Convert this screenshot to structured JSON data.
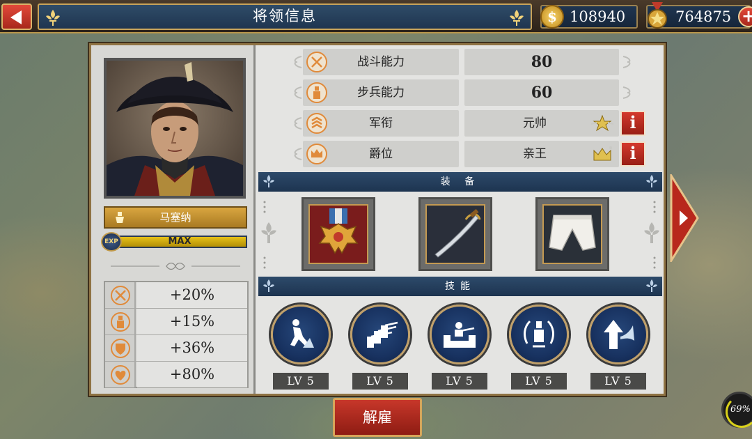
{
  "header": {
    "title": "将领信息",
    "coins": "108940",
    "medals": "764875",
    "back_icon": "back-arrow-icon",
    "coin_symbol": "$",
    "plus_symbol": "+"
  },
  "general": {
    "name": "马塞纳",
    "exp_badge": "EXP",
    "exp_text": "MAX",
    "exp_progress": 1.0
  },
  "bonuses": [
    {
      "icon": "crossed-swords-icon",
      "value": "+20%"
    },
    {
      "icon": "infantry-icon",
      "value": "+15%"
    },
    {
      "icon": "shield-icon",
      "value": "+36%"
    },
    {
      "icon": "heart-icon",
      "value": "+80%"
    }
  ],
  "stats": [
    {
      "label": "战斗能力",
      "value": "80"
    },
    {
      "label": "步兵能力",
      "value": "60"
    },
    {
      "label": "军衔",
      "value": "元帅"
    },
    {
      "label": "爵位",
      "value": "亲王"
    }
  ],
  "info_symbol": "i",
  "equipment": {
    "title": "装 备",
    "items": [
      "medal-icon",
      "sabre-icon",
      "trousers-icon"
    ]
  },
  "skills": {
    "title": "技能",
    "items": [
      {
        "icon": "charge-icon",
        "level": "LV 5"
      },
      {
        "icon": "volley-icon",
        "level": "LV 5"
      },
      {
        "icon": "entrench-icon",
        "level": "LV 5"
      },
      {
        "icon": "guard-icon",
        "level": "LV 5"
      },
      {
        "icon": "bugle-icon",
        "level": "LV 5"
      }
    ]
  },
  "dismiss_label": "解雇",
  "fps": "69%",
  "colors": {
    "accent_red": "#b02a1e",
    "header_blue": "#1f3550",
    "gold": "#c9a45a"
  }
}
